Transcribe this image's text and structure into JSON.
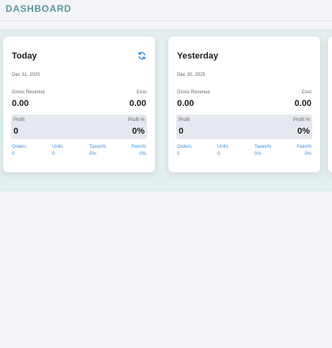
{
  "app": {
    "title": "DASHBOARD"
  },
  "colors": {
    "accent": "#5c9aa0",
    "link": "#3d8ee0",
    "band": "#e3eeee",
    "profit_bg": "#e5e8ee"
  },
  "cards": [
    {
      "title": "Today",
      "date": "Dec 31, 2025",
      "refresh_icon": "refresh-icon",
      "gross_revenue_label": "Gross Revenue",
      "gross_revenue": "0.00",
      "cost_label": "Cost",
      "cost": "0.00",
      "profit_label": "Profit",
      "profit": "0",
      "profit_pct_label": "Profit %",
      "profit_pct": "0%",
      "stats": [
        {
          "label": "Orders",
          "value": "0"
        },
        {
          "label": "Units",
          "value": "0"
        },
        {
          "label": "Taxes%",
          "value": "0%"
        },
        {
          "label": "Fees%",
          "value": "0%"
        }
      ]
    },
    {
      "title": "Yesterday",
      "date": "Dec 30, 2025",
      "gross_revenue_label": "Gross Revenue",
      "gross_revenue": "0.00",
      "cost_label": "Cost",
      "cost": "0.00",
      "profit_label": "Profit",
      "profit": "0",
      "profit_pct_label": "Profit %",
      "profit_pct": "0%",
      "stats": [
        {
          "label": "Orders",
          "value": "0"
        },
        {
          "label": "Units",
          "value": "0"
        },
        {
          "label": "Taxes%",
          "value": "0%"
        },
        {
          "label": "Fees%",
          "value": "0%"
        }
      ]
    }
  ]
}
